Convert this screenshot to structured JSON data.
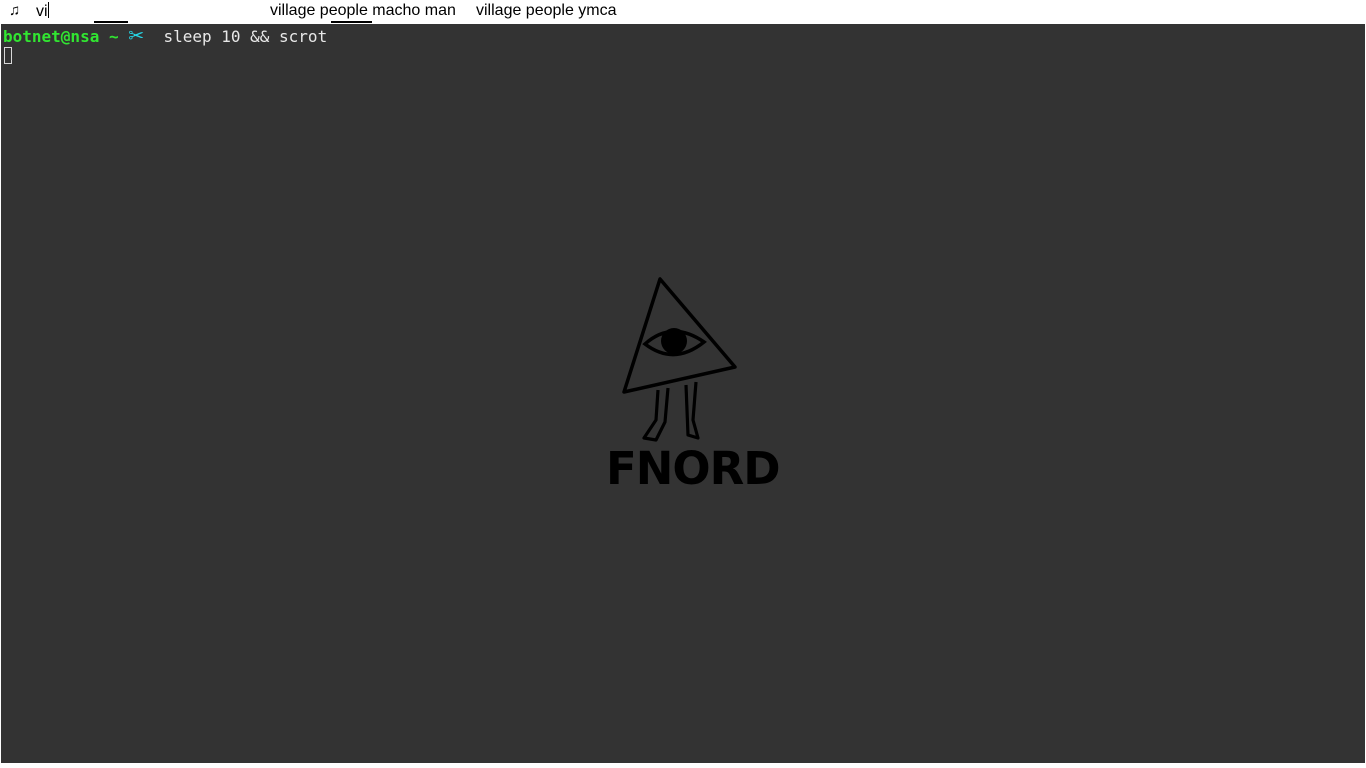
{
  "launcher": {
    "icon": "music-note-icon",
    "icon_glyph": "♫",
    "query": "vi",
    "results": [
      "village people macho man",
      "village people ymca"
    ]
  },
  "terminal": {
    "user_host": "botnet@nsa",
    "cwd": "~",
    "prompt_symbol": "✂",
    "command": "sleep 10 && scrot",
    "background_color": "#333333",
    "user_color": "#31e631",
    "symbol_color": "#26d6e6"
  },
  "wallpaper": {
    "logo": "eye-pyramid-icon",
    "caption": "FNORD"
  }
}
